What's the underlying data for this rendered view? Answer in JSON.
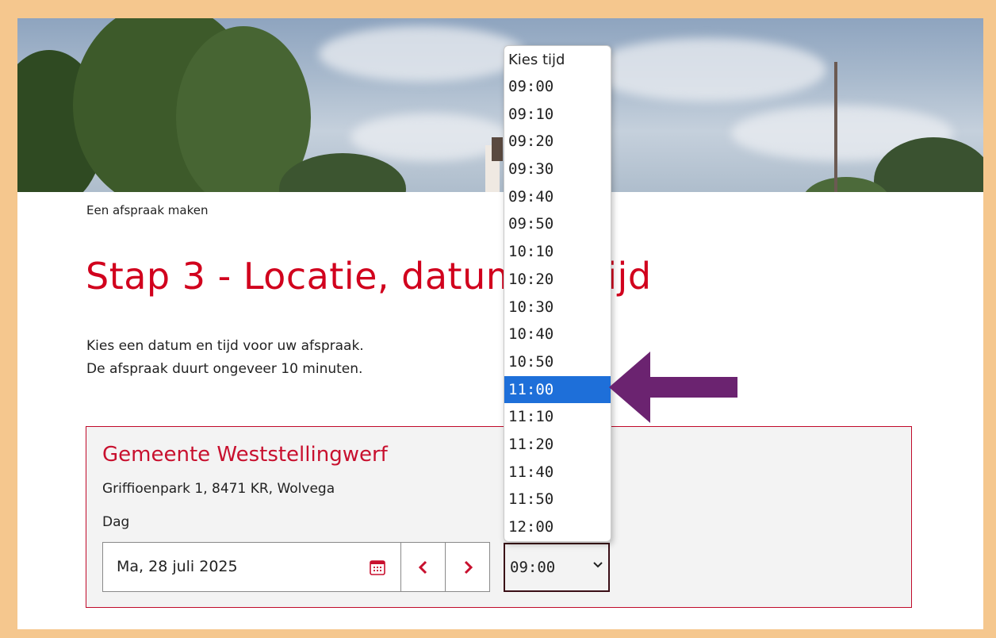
{
  "header": {
    "breadcrumb": "Een afspraak maken",
    "title": "Stap 3 - Locatie, datum en tijd"
  },
  "intro": {
    "line1": "Kies een datum en tijd voor uw afspraak.",
    "line2": "De afspraak duurt ongeveer 10 minuten."
  },
  "location": {
    "name": "Gemeente Weststellingwerf",
    "address": "Griffioenpark 1, 8471 KR, Wolvega",
    "day_label": "Dag",
    "date_value": "Ma, 28 juli 2025",
    "prev_label": "‹",
    "next_label": "›",
    "time_value": "09:00"
  },
  "time_dropdown": {
    "placeholder": "Kies tijd",
    "options": [
      "09:00",
      "09:10",
      "09:20",
      "09:30",
      "09:40",
      "09:50",
      "10:10",
      "10:20",
      "10:30",
      "10:40",
      "10:50",
      "11:00",
      "11:10",
      "11:20",
      "11:40",
      "11:50",
      "12:00"
    ],
    "highlighted": "11:00"
  },
  "colors": {
    "brand_red": "#c8102e",
    "highlight_blue": "#1e6fd9",
    "arrow_purple": "#6b2370",
    "frame_border": "#f5c78e"
  },
  "icons": {
    "calendar": "calendar-icon",
    "prev": "chevron-left-icon",
    "next": "chevron-right-icon",
    "select": "chevron-down-icon",
    "pointer": "arrow-left-icon"
  }
}
